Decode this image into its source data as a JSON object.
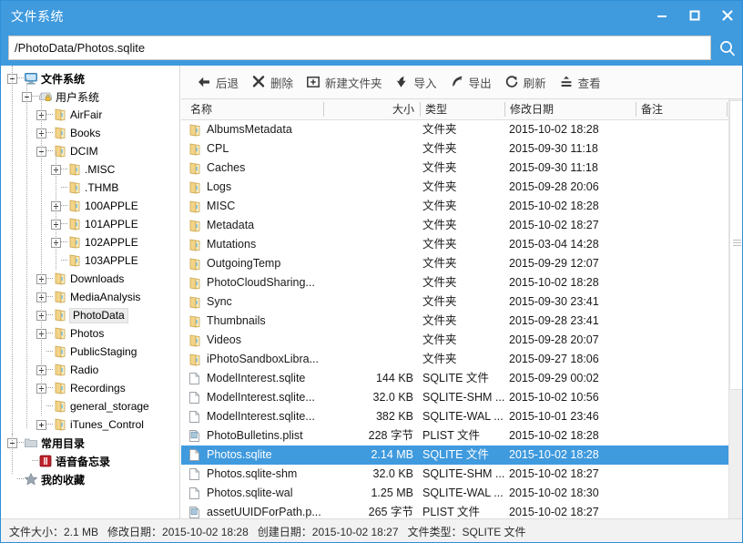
{
  "window": {
    "title": "文件系统",
    "minimize_label": "minimize",
    "maximize_label": "maximize",
    "close_label": "close"
  },
  "pathbar": {
    "value": "/PhotoData/Photos.sqlite",
    "placeholder": "",
    "search_icon": "search-icon"
  },
  "toolbar": {
    "buttons": [
      {
        "icon": "arrow-left-icon",
        "label": "后退"
      },
      {
        "icon": "cross-icon",
        "label": "删除"
      },
      {
        "icon": "new-folder-icon",
        "label": "新建文件夹"
      },
      {
        "icon": "import-arrow-down-icon",
        "label": "导入"
      },
      {
        "icon": "export-arrow-up-icon",
        "label": "导出"
      },
      {
        "icon": "refresh-icon",
        "label": "刷新"
      },
      {
        "icon": "view-icon",
        "label": "查看"
      }
    ]
  },
  "sidebar": {
    "nodes": [
      {
        "label": "文件系统",
        "depth": 0,
        "expander": "minus",
        "icon": "computer-icon",
        "bold": true,
        "selected": false
      },
      {
        "label": "用户系统",
        "depth": 1,
        "expander": "minus",
        "icon": "drive-lock-icon",
        "bold": false,
        "selected": false
      },
      {
        "label": "AirFair",
        "depth": 2,
        "expander": "plus",
        "icon": "folder-icon",
        "bold": false,
        "selected": false
      },
      {
        "label": "Books",
        "depth": 2,
        "expander": "plus",
        "icon": "folder-icon",
        "bold": false,
        "selected": false
      },
      {
        "label": "DCIM",
        "depth": 2,
        "expander": "minus",
        "icon": "folder-icon",
        "bold": false,
        "selected": false
      },
      {
        "label": ".MISC",
        "depth": 3,
        "expander": "plus",
        "icon": "folder-icon",
        "bold": false,
        "selected": false
      },
      {
        "label": ".THMB",
        "depth": 3,
        "expander": "none",
        "icon": "folder-icon",
        "bold": false,
        "selected": false
      },
      {
        "label": "100APPLE",
        "depth": 3,
        "expander": "plus",
        "icon": "folder-icon",
        "bold": false,
        "selected": false
      },
      {
        "label": "101APPLE",
        "depth": 3,
        "expander": "plus",
        "icon": "folder-icon",
        "bold": false,
        "selected": false
      },
      {
        "label": "102APPLE",
        "depth": 3,
        "expander": "plus",
        "icon": "folder-icon",
        "bold": false,
        "selected": false
      },
      {
        "label": "103APPLE",
        "depth": 3,
        "expander": "none",
        "icon": "folder-icon",
        "bold": false,
        "selected": false
      },
      {
        "label": "Downloads",
        "depth": 2,
        "expander": "plus",
        "icon": "folder-icon",
        "bold": false,
        "selected": false
      },
      {
        "label": "MediaAnalysis",
        "depth": 2,
        "expander": "plus",
        "icon": "folder-icon",
        "bold": false,
        "selected": false
      },
      {
        "label": "PhotoData",
        "depth": 2,
        "expander": "plus",
        "icon": "folder-icon",
        "bold": false,
        "selected": true
      },
      {
        "label": "Photos",
        "depth": 2,
        "expander": "plus",
        "icon": "folder-icon",
        "bold": false,
        "selected": false
      },
      {
        "label": "PublicStaging",
        "depth": 2,
        "expander": "none",
        "icon": "folder-icon",
        "bold": false,
        "selected": false
      },
      {
        "label": "Radio",
        "depth": 2,
        "expander": "plus",
        "icon": "folder-icon",
        "bold": false,
        "selected": false
      },
      {
        "label": "Recordings",
        "depth": 2,
        "expander": "plus",
        "icon": "folder-icon",
        "bold": false,
        "selected": false
      },
      {
        "label": "general_storage",
        "depth": 2,
        "expander": "none",
        "icon": "folder-icon",
        "bold": false,
        "selected": false
      },
      {
        "label": "iTunes_Control",
        "depth": 2,
        "expander": "plus",
        "icon": "folder-icon",
        "bold": false,
        "selected": false
      },
      {
        "label": "常用目录",
        "depth": 0,
        "expander": "minus",
        "icon": "grey-folder-icon",
        "bold": true,
        "selected": false
      },
      {
        "label": "语音备忘录",
        "depth": 1,
        "expander": "none",
        "icon": "voice-memo-icon",
        "bold": true,
        "selected": false
      },
      {
        "label": "我的收藏",
        "depth": 0,
        "expander": "none",
        "icon": "star-icon",
        "bold": true,
        "selected": false
      }
    ]
  },
  "filelist": {
    "columns": [
      {
        "key": "name",
        "label": "名称"
      },
      {
        "key": "size",
        "label": "大小"
      },
      {
        "key": "type",
        "label": "类型"
      },
      {
        "key": "date",
        "label": "修改日期"
      },
      {
        "key": "note",
        "label": "备注"
      }
    ],
    "rows": [
      {
        "icon": "folder-icon",
        "name": "AlbumsMetadata",
        "size": "",
        "type": "文件夹",
        "date": "2015-10-02 18:28",
        "note": "",
        "selected": false
      },
      {
        "icon": "folder-icon",
        "name": "CPL",
        "size": "",
        "type": "文件夹",
        "date": "2015-09-30 11:18",
        "note": "",
        "selected": false
      },
      {
        "icon": "folder-icon",
        "name": "Caches",
        "size": "",
        "type": "文件夹",
        "date": "2015-09-30 11:18",
        "note": "",
        "selected": false
      },
      {
        "icon": "folder-icon",
        "name": "Logs",
        "size": "",
        "type": "文件夹",
        "date": "2015-09-28 20:06",
        "note": "",
        "selected": false
      },
      {
        "icon": "folder-icon",
        "name": "MISC",
        "size": "",
        "type": "文件夹",
        "date": "2015-10-02 18:28",
        "note": "",
        "selected": false
      },
      {
        "icon": "folder-icon",
        "name": "Metadata",
        "size": "",
        "type": "文件夹",
        "date": "2015-10-02 18:27",
        "note": "",
        "selected": false
      },
      {
        "icon": "folder-icon",
        "name": "Mutations",
        "size": "",
        "type": "文件夹",
        "date": "2015-03-04 14:28",
        "note": "",
        "selected": false
      },
      {
        "icon": "folder-icon",
        "name": "OutgoingTemp",
        "size": "",
        "type": "文件夹",
        "date": "2015-09-29 12:07",
        "note": "",
        "selected": false
      },
      {
        "icon": "folder-icon",
        "name": "PhotoCloudSharing...",
        "size": "",
        "type": "文件夹",
        "date": "2015-10-02 18:28",
        "note": "",
        "selected": false
      },
      {
        "icon": "folder-icon",
        "name": "Sync",
        "size": "",
        "type": "文件夹",
        "date": "2015-09-30 23:41",
        "note": "",
        "selected": false
      },
      {
        "icon": "folder-icon",
        "name": "Thumbnails",
        "size": "",
        "type": "文件夹",
        "date": "2015-09-28 23:41",
        "note": "",
        "selected": false
      },
      {
        "icon": "folder-icon",
        "name": "Videos",
        "size": "",
        "type": "文件夹",
        "date": "2015-09-28 20:07",
        "note": "",
        "selected": false
      },
      {
        "icon": "folder-icon",
        "name": "iPhotoSandboxLibra...",
        "size": "",
        "type": "文件夹",
        "date": "2015-09-27 18:06",
        "note": "",
        "selected": false
      },
      {
        "icon": "file-icon",
        "name": "ModelInterest.sqlite",
        "size": "144 KB",
        "type": "SQLITE 文件",
        "date": "2015-09-29 00:02",
        "note": "",
        "selected": false
      },
      {
        "icon": "file-icon",
        "name": "ModelInterest.sqlite...",
        "size": "32.0 KB",
        "type": "SQLITE-SHM ...",
        "date": "2015-10-02 10:56",
        "note": "",
        "selected": false
      },
      {
        "icon": "file-icon",
        "name": "ModelInterest.sqlite...",
        "size": "382 KB",
        "type": "SQLITE-WAL ...",
        "date": "2015-10-01 23:46",
        "note": "",
        "selected": false
      },
      {
        "icon": "plist-icon",
        "name": "PhotoBulletins.plist",
        "size": "228 字节",
        "type": "PLIST 文件",
        "date": "2015-10-02 18:28",
        "note": "",
        "selected": false
      },
      {
        "icon": "file-icon",
        "name": "Photos.sqlite",
        "size": "2.14 MB",
        "type": "SQLITE 文件",
        "date": "2015-10-02 18:28",
        "note": "",
        "selected": true
      },
      {
        "icon": "file-icon",
        "name": "Photos.sqlite-shm",
        "size": "32.0 KB",
        "type": "SQLITE-SHM ...",
        "date": "2015-10-02 18:27",
        "note": "",
        "selected": false
      },
      {
        "icon": "file-icon",
        "name": "Photos.sqlite-wal",
        "size": "1.25 MB",
        "type": "SQLITE-WAL ...",
        "date": "2015-10-02 18:30",
        "note": "",
        "selected": false
      },
      {
        "icon": "plist-icon",
        "name": "assetUUIDForPath.p...",
        "size": "265 字节",
        "type": "PLIST 文件",
        "date": "2015-10-02 18:27",
        "note": "",
        "selected": false
      }
    ]
  },
  "statusbar": {
    "file_size": "文件大小：2.1 MB",
    "modified_date": "修改日期：2015-10-02 18:28",
    "created_date": "创建日期：2015-10-02 18:27",
    "file_type": "文件类型：SQLITE 文件"
  },
  "colors": {
    "accent": "#3f9ade",
    "selection": "#3f9ade",
    "folder": "#f6d98a",
    "toolbar_bg": "#fbfbfb"
  }
}
